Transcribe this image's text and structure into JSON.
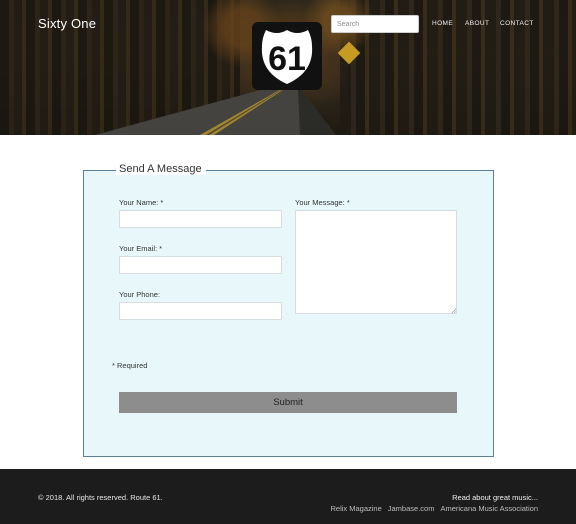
{
  "header": {
    "brand": "Sixty One",
    "shield_number": "61",
    "search": {
      "placeholder": "Search",
      "value": ""
    },
    "nav": {
      "home": "HOME",
      "about": "ABOUT",
      "contact": "CONTACT"
    }
  },
  "form": {
    "legend": "Send A Message",
    "name_label": "Your Name: *",
    "email_label": "Your Email: *",
    "phone_label": "Your Phone:",
    "message_label": "Your Message: *",
    "required_note": "* Required",
    "submit_label": "Submit"
  },
  "footer": {
    "copyright": "© 2018. All rights reserved. Route 61.",
    "read_more": "Read about great music...",
    "links": [
      "Relix Magazine",
      "Jambase.com",
      "Americana Music Association"
    ]
  },
  "colors": {
    "fieldset_bg": "#e8f8fa",
    "fieldset_border": "#5b7f96",
    "submit_bg": "#8d8d8d",
    "footer_bg": "#1c1c1c"
  }
}
